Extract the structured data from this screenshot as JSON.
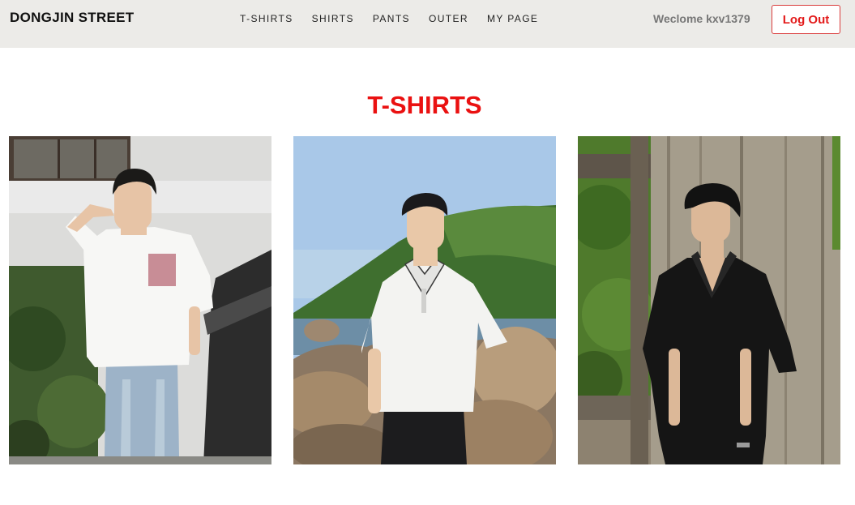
{
  "header": {
    "brand": "DONGJIN STREET",
    "nav": [
      "T-SHIRTS",
      "SHIRTS",
      "PANTS",
      "OUTER",
      "MY PAGE"
    ],
    "welcome": "Weclome kxv1379",
    "logout_label": "Log Out"
  },
  "colors": {
    "nav_bg": "#ecebe8",
    "accent": "#ea1111"
  },
  "main": {
    "title": "T-SHIRTS",
    "products": [
      {
        "image": "product-photo-white-graphic-tee"
      },
      {
        "image": "product-photo-white-polo-shirt"
      },
      {
        "image": "product-photo-black-open-collar-shirt"
      }
    ]
  }
}
